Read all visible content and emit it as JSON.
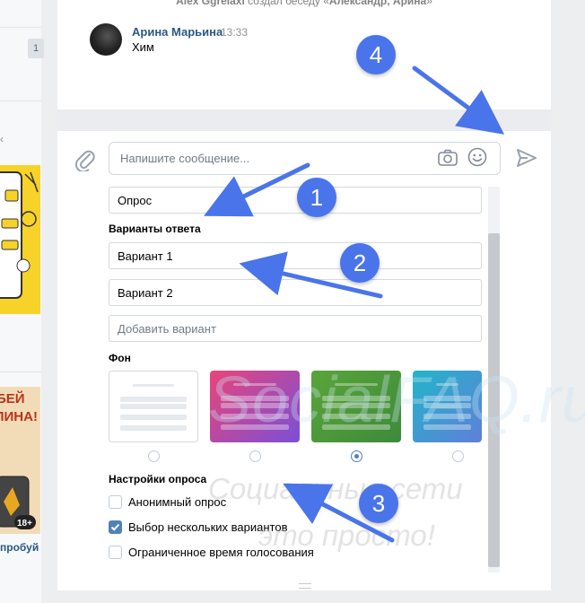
{
  "sidebar": {
    "counter": "1",
    "ad1_caption": "бей\nлина!",
    "ad1_badge": "18+",
    "ad_caption": "пробуй"
  },
  "chat": {
    "system_message_parts": [
      "Alex Ggrelaxi",
      " создал беседу «",
      "Александр, Арина",
      "»"
    ],
    "message": {
      "author": "Арина Марьина",
      "time": "13:33",
      "text": "Хим"
    }
  },
  "compose": {
    "placeholder": "Напишите сообщение..."
  },
  "poll": {
    "question": "Опрос",
    "answers_title": "Варианты ответа",
    "options": [
      "Вариант 1",
      "Вариант 2"
    ],
    "add_option_placeholder": "Добавить вариант",
    "background_title": "Фон",
    "backgrounds": [
      {
        "name": "white",
        "colors": [
          "#ffffff",
          "#ffffff"
        ],
        "selected": false
      },
      {
        "name": "pink-purple",
        "colors": [
          "#e8457a",
          "#7b4fd6"
        ],
        "selected": false
      },
      {
        "name": "green",
        "colors": [
          "#5aa53a",
          "#3d8a3b"
        ],
        "selected": true
      },
      {
        "name": "teal-blue",
        "colors": [
          "#22b5c9",
          "#5f7fd8"
        ],
        "selected": false
      }
    ],
    "settings_title": "Настройки опроса",
    "settings": [
      {
        "label": "Анонимный опрос",
        "checked": false
      },
      {
        "label": "Выбор нескольких вариантов",
        "checked": true
      },
      {
        "label": "Ограниченное время голосования",
        "checked": false
      }
    ]
  },
  "watermark": {
    "logo": "SocialFAQ.ru",
    "line1": "Социальные сети",
    "line2": "это просто!"
  },
  "annotations": [
    "1",
    "2",
    "3",
    "4"
  ],
  "colors": {
    "accent": "#5181b8",
    "link": "#2a5885",
    "annotation": "#4a74ea"
  }
}
